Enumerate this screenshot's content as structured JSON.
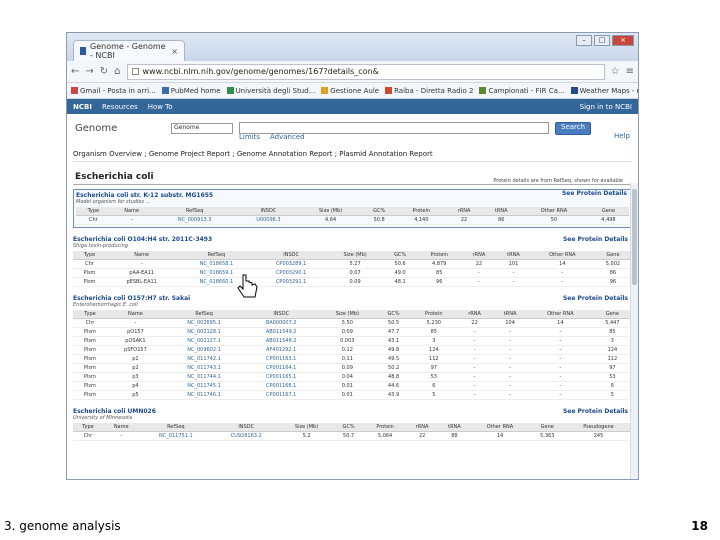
{
  "browser": {
    "tab_title": "Genome - Genome - NCBI",
    "url": "www.ncbi.nlm.nih.gov/genome/genomes/167?details_con&",
    "bookmarks": [
      "Gmail - Posta in arri...",
      "PubMed home",
      "Università degli Stud...",
      "Gestione Aule",
      "Raiba - Diretta Radio 2",
      "Campionati - FIR Ca...",
      "Weather Maps - me..."
    ]
  },
  "ncbi": {
    "nav": [
      "NCBI",
      "Resources",
      "How To"
    ],
    "signin": "Sign in to NCBI",
    "db_label": "Genome",
    "db_select": "Genome",
    "search_button": "Search",
    "links": [
      "Limits",
      "Advanced"
    ],
    "help": "Help"
  },
  "breadcrumb": "Organism Overview ; Genome Project Report ; Genome Annotation Report ; Plasmid Annotation Report",
  "organism": "Escherichia coli",
  "note": "Protein details are from RefSeq, shown for available",
  "protein_link": "See Protein Details",
  "top_table": {
    "title": "Escherichia coli str. K-12 substr. MG1655",
    "subtitle": "Model organism for studies ...",
    "headers": [
      "Type",
      "Name",
      "RefSeq",
      "INSDC",
      "Size (Mb)",
      "GC%",
      "Protein",
      "rRNA",
      "tRNA",
      "Other RNA",
      "Gene"
    ],
    "rows": [
      [
        "Chr",
        "-",
        "NC_000913.3",
        "U00096.3",
        "4.64",
        "50.8",
        "4,140",
        "22",
        "86",
        "50",
        "4,498"
      ]
    ]
  },
  "sections": [
    {
      "title": "Escherichia coli O104:H4 str. 2011C-3493",
      "subtitle": "Shiga toxin-producing",
      "headers": [
        "Type",
        "Name",
        "RefSeq",
        "INSDC",
        "Size (Mb)",
        "GC%",
        "Protein",
        "rRNA",
        "tRNA",
        "Other RNA",
        "Gene"
      ],
      "rows": [
        [
          "Chr",
          "-",
          "NC_018658.1",
          "CP003289.1",
          "5.27",
          "50.6",
          "4,879",
          "22",
          "101",
          "14",
          "5,002"
        ],
        [
          "Plsm",
          "pAA-EA11",
          "NC_018659.1",
          "CP003290.1",
          "0.07",
          "49.0",
          "85",
          "-",
          "-",
          "-",
          "86"
        ],
        [
          "Plsm",
          "pESBL-EA11",
          "NC_018660.1",
          "CP003291.1",
          "0.09",
          "48.1",
          "96",
          "-",
          "-",
          "-",
          "96"
        ]
      ]
    },
    {
      "title": "Escherichia coli O157:H7 str. Sakai",
      "subtitle": "Enterohemorrhagic E. coli",
      "headers": [
        "Type",
        "Name",
        "RefSeq",
        "INSDC",
        "Size (Mb)",
        "GC%",
        "Protein",
        "rRNA",
        "tRNA",
        "Other RNA",
        "Gene"
      ],
      "rows": [
        [
          "Chr",
          "-",
          "NC_002695.1",
          "BA000007.2",
          "5.50",
          "50.5",
          "5,230",
          "22",
          "104",
          "14",
          "5,447"
        ],
        [
          "Plsm",
          "pO157",
          "NC_002128.1",
          "AB011549.2",
          "0.09",
          "47.7",
          "85",
          "-",
          "-",
          "-",
          "85"
        ],
        [
          "Plsm",
          "pOSAK1",
          "NC_002127.1",
          "AB011548.2",
          "0.003",
          "43.1",
          "3",
          "-",
          "-",
          "-",
          "3"
        ],
        [
          "Plsm",
          "pSFO157",
          "NC_009602.1",
          "AF401292.1",
          "0.12",
          "49.8",
          "124",
          "-",
          "-",
          "-",
          "124"
        ],
        [
          "Plsm",
          "p1",
          "NC_011742.1",
          "CP001163.1",
          "0.11",
          "49.5",
          "112",
          "-",
          "-",
          "-",
          "112"
        ],
        [
          "Plsm",
          "p2",
          "NC_011743.1",
          "CP001164.1",
          "0.09",
          "50.2",
          "97",
          "-",
          "-",
          "-",
          "97"
        ],
        [
          "Plsm",
          "p3",
          "NC_011744.1",
          "CP001165.1",
          "0.04",
          "48.8",
          "53",
          "-",
          "-",
          "-",
          "53"
        ],
        [
          "Plsm",
          "p4",
          "NC_011745.1",
          "CP001166.1",
          "0.01",
          "44.6",
          "6",
          "-",
          "-",
          "-",
          "6"
        ],
        [
          "Plsm",
          "p5",
          "NC_011746.1",
          "CP001167.1",
          "0.01",
          "43.9",
          "5",
          "-",
          "-",
          "-",
          "5"
        ]
      ]
    },
    {
      "title": "Escherichia coli UMN026",
      "subtitle": "University of Minnesota",
      "headers": [
        "Type",
        "Name",
        "RefSeq",
        "INSDC",
        "Size (Mb)",
        "GC%",
        "Protein",
        "rRNA",
        "tRNA",
        "Other RNA",
        "Gene",
        "Pseudogene"
      ],
      "rows": [
        [
          "Chr",
          "-",
          "NC_011751.1",
          "CU928163.2",
          "5.2",
          "50.7",
          "5,064",
          "22",
          "88",
          "14",
          "5,363",
          "245"
        ]
      ]
    }
  ],
  "footer": {
    "left": "3. genome analysis",
    "page": "18"
  }
}
